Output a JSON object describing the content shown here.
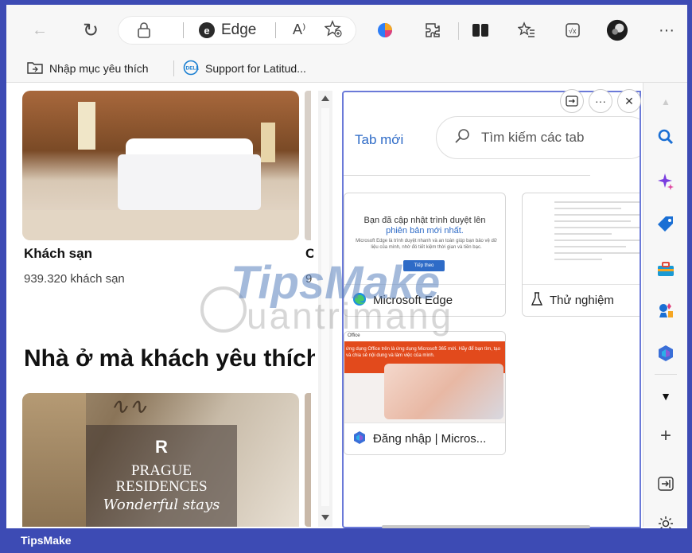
{
  "toolbar": {
    "back": "←",
    "refresh": "↻",
    "lock": "🔒",
    "address_brand": "Edge",
    "read_aloud": "A⁾",
    "more": "···"
  },
  "favorites": {
    "import_label": "Nhập mục yêu thích",
    "support_label": "Support for Latitud..."
  },
  "page": {
    "hotel_title": "Khách sạn",
    "hotel_count": "939.320 khách sạn",
    "clip_title": "C",
    "clip_sub": "9",
    "section_heading": "Nhà ở mà khách yêu thích",
    "prague_logo": "R",
    "prague_name": "PRAGUE RESIDENCES",
    "prague_tagline": "Wonderful stays"
  },
  "tab_panel": {
    "new_tab": "Tab mới",
    "search_placeholder": "Tìm kiếm các tab",
    "tabs": [
      {
        "title": "Microsoft Edge",
        "preview_line1": "Bạn đã cập nhật trình duyệt lên",
        "preview_line2": "phiên bản mới nhất.",
        "preview_body": "Microsoft Edge là trình duyệt nhanh và an toàn giúp bạn bảo vệ dữ liệu của mình, nhờ đó tiết kiệm thời gian và tiền bạc.",
        "preview_button": "Tiếp theo"
      },
      {
        "title": "Thử nghiệm"
      },
      {
        "title": "Đăng nhập | Micros...",
        "preview_app": "Office",
        "preview_banner": "ứng dụng Office trên là ứng dụng Microsoft 365 mới. Hãy để bạn tìm, tạo và chia sẻ nội dung và làm việc của mình."
      }
    ]
  },
  "watermark": {
    "brand": "TipsMake",
    "brand2": "uantrimang"
  },
  "footer": {
    "label": "TipsMake"
  }
}
